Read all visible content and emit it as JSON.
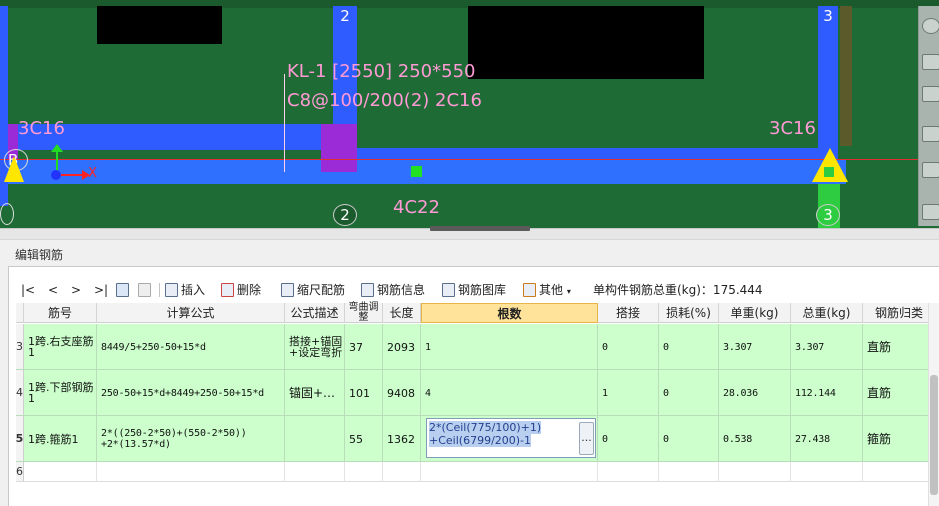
{
  "viewport": {
    "beam_label_line1": "KL-1 [2550] 250*550",
    "beam_label_line2": "C8@100/200(2) 2C16",
    "left_top_rebar": "3C16",
    "right_top_rebar": "3C16",
    "bottom_rebar": "4C22",
    "axis_top_2": "2",
    "axis_top_3": "3",
    "axis_bottom_2": "2",
    "axis_bottom_3": "3",
    "axis_left_b": "B",
    "axis_right_b": "B",
    "axis_x_label": "X",
    "colors": {
      "background": "#1f6b35",
      "beam": "#2f5cff",
      "column_marker": "#9a2bd6",
      "support": "#ffe600",
      "text": "#ff9ad5",
      "axis_line": "#e03030"
    }
  },
  "panel": {
    "title": "编辑钢筋",
    "toolbar": {
      "nav_first": "|<",
      "nav_prev": "<",
      "nav_next": ">",
      "nav_last": ">|",
      "insert": "插入",
      "delete": "删除",
      "ruler": "缩尺配筋",
      "info": "钢筋信息",
      "library": "钢筋图库",
      "other": "其他",
      "total_weight": "单构件钢筋总重(kg)：175.444"
    },
    "columns": [
      "筋号",
      "计算公式",
      "公式描述",
      "弯曲调整",
      "长度",
      "根数",
      "搭接",
      "损耗(%)",
      "单重(kg)",
      "总重(kg)",
      "钢筋归类"
    ],
    "rows": [
      {
        "num": "3",
        "name": "1跨.右支座筋1",
        "formula": "8449/5+250-50+15*d",
        "desc": "搭接+锚固+设定弯折",
        "bend": "37",
        "length": "2093",
        "count": "1",
        "lap": "0",
        "loss": "0",
        "unit_weight": "3.307",
        "total_weight": "3.307",
        "category": "直筋"
      },
      {
        "num": "4",
        "name": "1跨.下部钢筋1",
        "formula": "250-50+15*d+8449+250-50+15*d",
        "desc": "锚固+…",
        "bend": "101",
        "length": "9408",
        "count": "4",
        "lap": "1",
        "loss": "0",
        "unit_weight": "28.036",
        "total_weight": "112.144",
        "category": "直筋"
      },
      {
        "num": "5",
        "name": "1跨.箍筋1",
        "formula_line1": "2*((250-2*50)+(550-2*50))",
        "formula_line2": "+2*(13.57*d)",
        "desc": "",
        "bend": "55",
        "length": "1362",
        "count_line1": "2*(Ceil(775/100)+1)",
        "count_line2": "+Ceil(6799/200)-1",
        "lap": "0",
        "loss": "0",
        "unit_weight": "0.538",
        "total_weight": "27.438",
        "category": "箍筋"
      }
    ],
    "empty_row_num": "6",
    "ellipsis": "..."
  }
}
